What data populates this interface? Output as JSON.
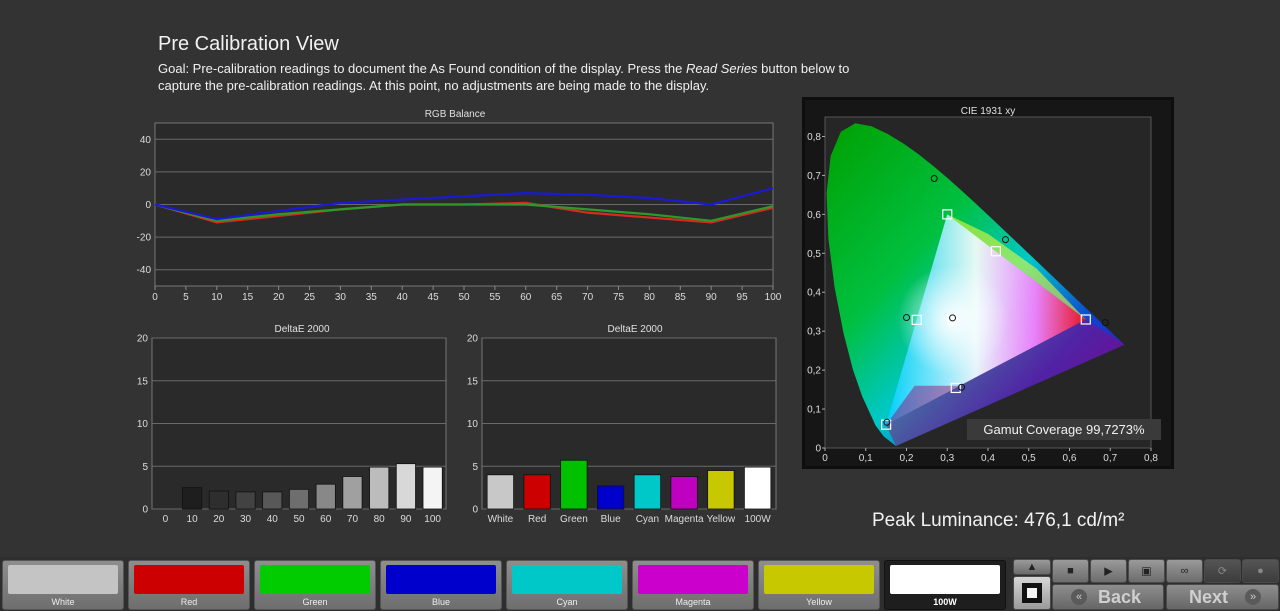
{
  "page": {
    "title": "Pre Calibration View",
    "goal_prefix": "Goal: Pre-calibration readings to document the As Found condition of the display. Press the ",
    "goal_emph": "Read Series",
    "goal_suffix": " button below to capture the pre-calibration readings. At this point, no adjustments are being made to the display.",
    "peak_luminance": "Peak Luminance: 476,1 cd/m²"
  },
  "chart_data": [
    {
      "type": "line",
      "title": "RGB Balance",
      "x": [
        0,
        10,
        20,
        30,
        40,
        50,
        60,
        70,
        80,
        90,
        100
      ],
      "xticks": [
        "0",
        "5",
        "10",
        "15",
        "20",
        "25",
        "30",
        "35",
        "40",
        "45",
        "50",
        "55",
        "60",
        "65",
        "70",
        "75",
        "80",
        "85",
        "90",
        "95",
        "100"
      ],
      "yticks": [
        "40",
        "20",
        "0",
        "-20",
        "-40"
      ],
      "ylim": [
        -50,
        50
      ],
      "grid": true,
      "series": [
        {
          "color": "#d82a1f",
          "values": [
            0,
            -11,
            -7,
            -3,
            0,
            0,
            1,
            -5,
            -8,
            -11,
            -2
          ]
        },
        {
          "color": "#2a9a2a",
          "values": [
            0,
            -10,
            -6,
            -3,
            0,
            0,
            0,
            -3,
            -6,
            -10,
            -1
          ]
        },
        {
          "color": "#1a1ad6",
          "values": [
            0,
            -9,
            -4,
            1,
            3,
            5,
            7,
            6,
            4,
            0,
            10
          ]
        }
      ]
    },
    {
      "type": "bar",
      "title": "DeltaE 2000",
      "categories": [
        "0",
        "10",
        "20",
        "30",
        "40",
        "50",
        "60",
        "70",
        "80",
        "90",
        "100"
      ],
      "values": [
        0,
        2.5,
        2.1,
        2.0,
        2.0,
        2.3,
        2.9,
        3.8,
        4.9,
        5.3,
        4.9
      ],
      "bar_colors": [
        "#000000",
        "#1e1e1e",
        "#2e2e2e",
        "#424242",
        "#585858",
        "#6e6e6e",
        "#888888",
        "#a0a0a0",
        "#bcbcbc",
        "#d8d8d8",
        "#f4f4f4"
      ],
      "yticks": [
        "20",
        "15",
        "10",
        "5",
        "0"
      ],
      "ylim": [
        0,
        20
      ]
    },
    {
      "type": "bar",
      "title": "DeltaE 2000",
      "categories": [
        "White",
        "Red",
        "Green",
        "Blue",
        "Cyan",
        "Magenta",
        "Yellow",
        "100W"
      ],
      "values": [
        4.0,
        4.0,
        5.7,
        2.7,
        4.0,
        3.8,
        4.5,
        4.9
      ],
      "bar_colors": [
        "#c8c8c8",
        "#cc0000",
        "#00c000",
        "#0000cc",
        "#00c8c8",
        "#c000c0",
        "#c8c800",
        "#ffffff"
      ],
      "yticks": [
        "20",
        "15",
        "10",
        "5",
        "0"
      ],
      "ylim": [
        0,
        20
      ]
    },
    {
      "type": "scatter",
      "title": "CIE 1931 xy",
      "xticks": [
        "0",
        "0,1",
        "0,2",
        "0,3",
        "0,4",
        "0,5",
        "0,6",
        "0,7",
        "0,8"
      ],
      "yticks": [
        "0,8",
        "0,7",
        "0,6",
        "0,5",
        "0,4",
        "0,3",
        "0,2",
        "0,1",
        "0"
      ],
      "xlim": [
        0,
        0.8
      ],
      "ylim": [
        0,
        0.85
      ],
      "gamut_triangle": [
        [
          0.64,
          0.33
        ],
        [
          0.3,
          0.6
        ],
        [
          0.15,
          0.06
        ]
      ],
      "target_points": [
        [
          0.64,
          0.33
        ],
        [
          0.3,
          0.6
        ],
        [
          0.15,
          0.06
        ],
        [
          0.3127,
          0.329
        ],
        [
          0.225,
          0.329
        ],
        [
          0.3209,
          0.1542
        ],
        [
          0.4193,
          0.5053
        ]
      ],
      "measured_points": [
        [
          0.688,
          0.322
        ],
        [
          0.268,
          0.692
        ],
        [
          0.152,
          0.066
        ],
        [
          0.313,
          0.334
        ],
        [
          0.2,
          0.335
        ],
        [
          0.335,
          0.156
        ],
        [
          0.443,
          0.535
        ]
      ],
      "annotation": "Gamut Coverage 99,7273%"
    }
  ],
  "bottombar": {
    "swatches": [
      {
        "label": "White",
        "color": "#c4c4c4"
      },
      {
        "label": "Red",
        "color": "#cc0000"
      },
      {
        "label": "Green",
        "color": "#00cc00"
      },
      {
        "label": "Blue",
        "color": "#0000cc"
      },
      {
        "label": "Cyan",
        "color": "#00c8c8"
      },
      {
        "label": "Magenta",
        "color": "#cc00cc"
      },
      {
        "label": "Yellow",
        "color": "#c8c800"
      },
      {
        "label": "100W",
        "color": "#ffffff"
      }
    ],
    "back_label": "Back",
    "next_label": "Next"
  }
}
